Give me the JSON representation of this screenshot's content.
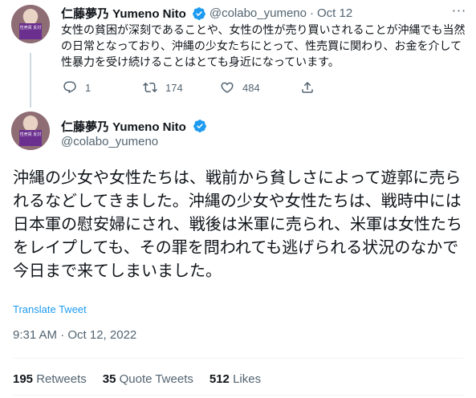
{
  "reply_tweet": {
    "author_name": "仁藤夢乃 Yumeno Nito",
    "handle": "@colabo_yumeno",
    "separator": "·",
    "date": "Oct 12",
    "more_label": "···",
    "avatar_sign": "性売買 反対",
    "text": "女性の貧困が深刻であることや、女性の性が売り買いされることが沖縄でも当然の日常となっており、沖縄の少女たちにとって、性売買に関わり、お金を介して性暴力を受け続けることはとても身近になっています。",
    "replies": "1",
    "retweets": "174",
    "likes": "484"
  },
  "main_tweet": {
    "author_name": "仁藤夢乃 Yumeno Nito",
    "handle": "@colabo_yumeno",
    "avatar_sign": "性売買 反対",
    "text": "沖縄の少女や女性たちは、戦前から貧しさによって遊郭に売られるなどしてきました。沖縄の少女や女性たちは、戦時中には日本軍の慰安婦にされ、戦後は米軍に売られ、米軍は女性たちをレイプしても、その罪を問われても逃げられる状況のなかで今日まで来てしまいました。",
    "translate_label": "Translate Tweet",
    "timestamp": "9:31 AM · Oct 12, 2022",
    "stats": {
      "retweets_count": "195",
      "retweets_label": "Retweets",
      "quotes_count": "35",
      "quotes_label": "Quote Tweets",
      "likes_count": "512",
      "likes_label": "Likes"
    }
  },
  "colors": {
    "accent": "#1d9bf0",
    "muted": "#536471",
    "text": "#0f1419",
    "divider": "#eff3f4"
  }
}
